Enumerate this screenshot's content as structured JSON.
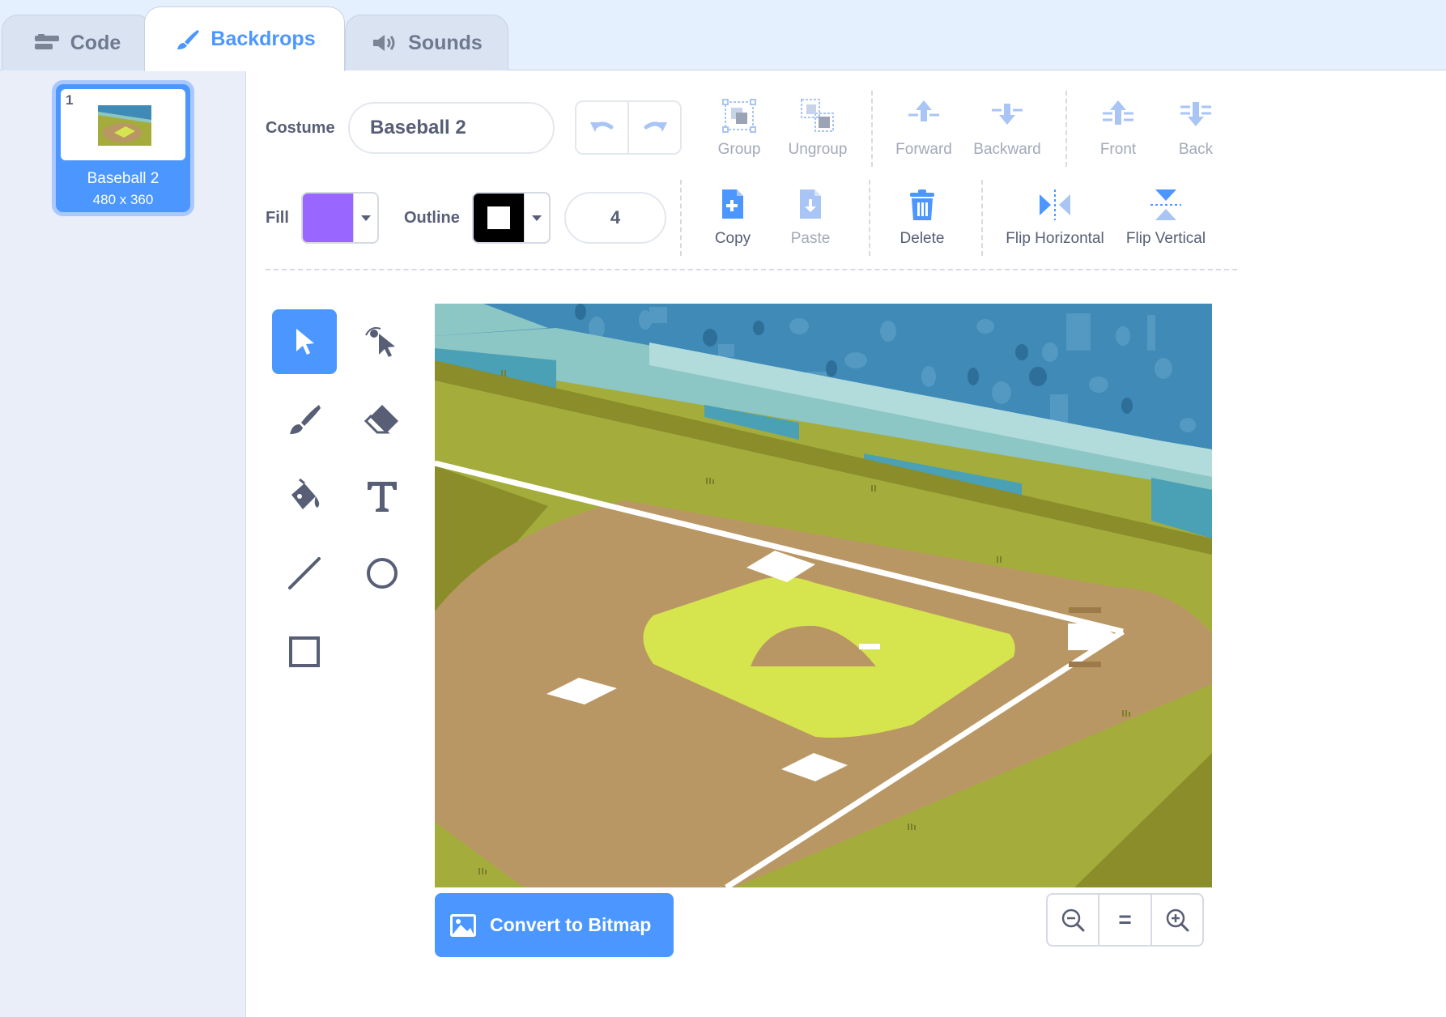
{
  "tabs": [
    {
      "label": "Code",
      "icon": "code-icon"
    },
    {
      "label": "Backdrops",
      "icon": "paintbrush-icon",
      "active": true
    },
    {
      "label": "Sounds",
      "icon": "speaker-icon"
    }
  ],
  "costume_list": [
    {
      "index": "1",
      "name": "Baseball 2",
      "size": "480 x 360",
      "selected": true
    }
  ],
  "toolbar": {
    "costume_label": "Costume",
    "costume_name": "Baseball 2",
    "group": "Group",
    "ungroup": "Ungroup",
    "forward": "Forward",
    "backward": "Backward",
    "front": "Front",
    "back": "Back",
    "fill_label": "Fill",
    "fill_color": "#9966ff",
    "outline_label": "Outline",
    "outline_color": "#000000",
    "outline_width": "4",
    "copy": "Copy",
    "paste": "Paste",
    "delete": "Delete",
    "flip_horizontal": "Flip Horizontal",
    "flip_vertical": "Flip Vertical"
  },
  "tools": [
    "select",
    "reshape",
    "brush",
    "eraser",
    "fill",
    "text",
    "line",
    "circle",
    "rectangle"
  ],
  "active_tool": "select",
  "convert_button": "Convert to Bitmap",
  "zoom": {
    "out": "zoom-out-icon",
    "reset": "=",
    "in": "zoom-in-icon"
  },
  "colors": {
    "accent": "#4c97ff",
    "grass": "#a4ad3c",
    "dirt": "#b99764",
    "infield": "#d6e54d",
    "sky": "#3f8ab6"
  }
}
